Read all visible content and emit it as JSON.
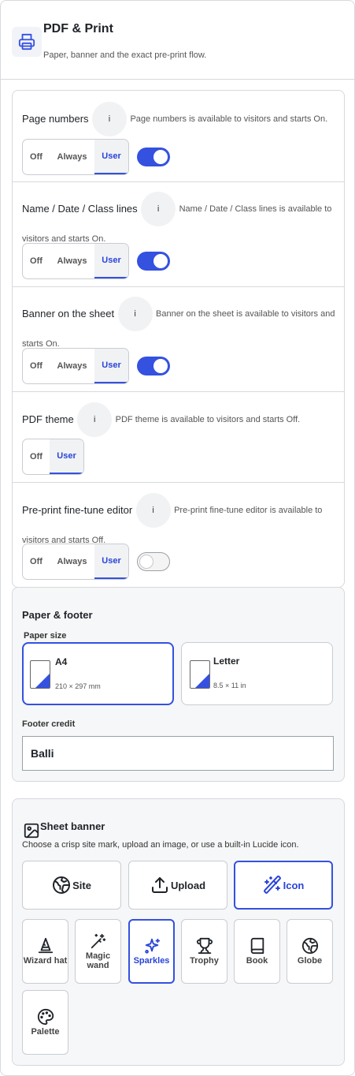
{
  "header": {
    "title": "PDF & Print",
    "subtitle": "Paper, banner and the exact pre-print flow.",
    "icon": "printer-icon"
  },
  "options": [
    {
      "label": "Page numbers",
      "info": "i",
      "description": "Page numbers is available to visitors and starts On.",
      "segments": [
        "Off",
        "Always",
        "User"
      ],
      "selected": "User",
      "toggle_on": true
    },
    {
      "label": "Name / Date / Class lines",
      "info": "i",
      "description": "Name / Date / Class lines is available to visitors and starts On.",
      "segments": [
        "Off",
        "Always",
        "User"
      ],
      "selected": "User",
      "toggle_on": true
    },
    {
      "label": "Banner on the sheet",
      "info": "i",
      "description": "Banner on the sheet is available to visitors and starts On.",
      "segments": [
        "Off",
        "Always",
        "User"
      ],
      "selected": "User",
      "toggle_on": true
    },
    {
      "label": "PDF theme",
      "info": "i",
      "description": "PDF theme is available to visitors and starts Off.",
      "segments": [
        "Off",
        "User"
      ],
      "selected": "User",
      "toggle_on": null
    },
    {
      "label": "Pre-print fine-tune editor",
      "info": "i",
      "description": "Pre-print fine-tune editor is available to visitors and starts Off.",
      "segments": [
        "Off",
        "Always",
        "User"
      ],
      "selected": "User",
      "toggle_on": false
    }
  ],
  "paper": {
    "title": "Paper & footer",
    "size_label": "Paper size",
    "sizes": [
      {
        "name": "A4",
        "dims": "210 × 297 mm",
        "selected": true
      },
      {
        "name": "Letter",
        "dims": "8.5 × 11 in",
        "selected": false
      }
    ],
    "footer_label": "Footer credit",
    "footer_value": "Balli"
  },
  "banner": {
    "title": "Sheet banner",
    "description": "Choose a crisp site mark, upload an image, or use a built-in Lucide icon.",
    "sources": [
      {
        "label": "Site",
        "icon": "globe-icon",
        "selected": false
      },
      {
        "label": "Upload",
        "icon": "upload-icon",
        "selected": false
      },
      {
        "label": "Icon",
        "icon": "wand-sparkles-icon",
        "selected": true
      }
    ],
    "icons": [
      {
        "label": "Wizard hat",
        "icon": "wizard-hat-icon",
        "selected": false
      },
      {
        "label": "Magic wand",
        "icon": "magic-wand-icon",
        "selected": false
      },
      {
        "label": "Sparkles",
        "icon": "sparkles-icon",
        "selected": true
      },
      {
        "label": "Trophy",
        "icon": "trophy-icon",
        "selected": false
      },
      {
        "label": "Book",
        "icon": "book-icon",
        "selected": false
      },
      {
        "label": "Globe",
        "icon": "globe-icon",
        "selected": false
      },
      {
        "label": "Palette",
        "icon": "palette-icon",
        "selected": false
      }
    ]
  },
  "colors": {
    "accent": "#3451e0",
    "border": "#d7d9de",
    "muted_bg": "#f6f7f8"
  }
}
